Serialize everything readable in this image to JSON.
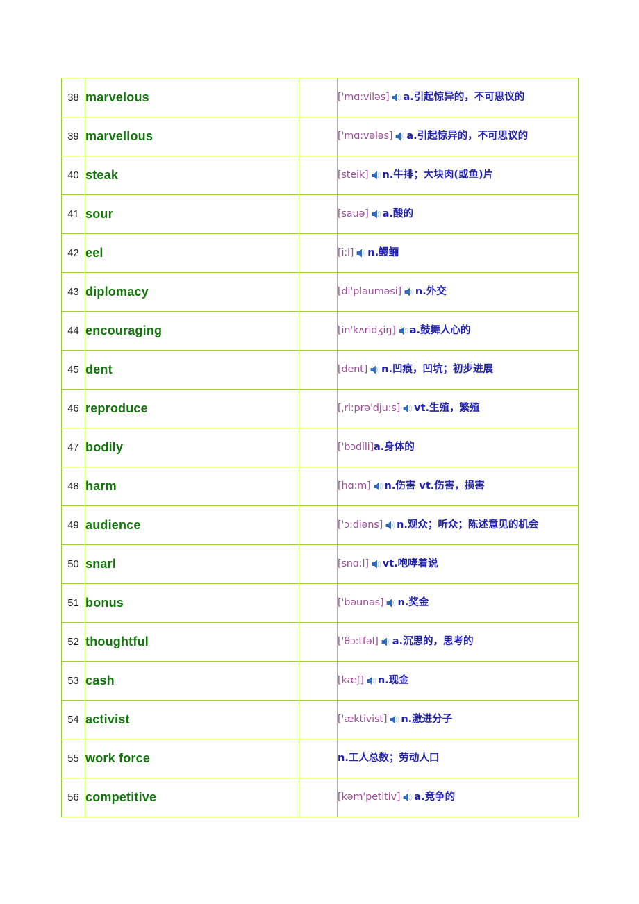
{
  "document": {
    "type": "vocabulary-table",
    "colors": {
      "border": "#9ACD32",
      "word": "#15730F",
      "phonetic": "#9B4F96",
      "meaning": "#2222AA",
      "number": "#1A1A1A"
    },
    "columns": [
      "number",
      "word",
      "spacer",
      "phonetic-and-meaning"
    ]
  },
  "rows": [
    {
      "num": "38",
      "word": "marvelous",
      "phon": "['mɑ:viləs]",
      "speaker": "speaker-icon",
      "meaning": "a.引起惊异的，不可思议的"
    },
    {
      "num": "39",
      "word": "marvellous",
      "phon": "['mɑ:vələs]",
      "speaker": "speaker-icon",
      "meaning": "a.引起惊异的，不可思议的"
    },
    {
      "num": "40",
      "word": "steak",
      "phon": "[steik]",
      "speaker": "speaker-icon",
      "meaning": "n.牛排；大块肉(或鱼)片"
    },
    {
      "num": "41",
      "word": "sour",
      "phon": "[sauə]",
      "speaker": "speaker-icon",
      "meaning": "a.酸的"
    },
    {
      "num": "42",
      "word": "eel",
      "phon": "[i:l]",
      "speaker": "speaker-icon",
      "meaning": "n.鳗鲡"
    },
    {
      "num": "43",
      "word": "diplomacy",
      "phon": "[di'pləuməsi]",
      "speaker": "speaker-icon",
      "meaning": "n.外交"
    },
    {
      "num": "44",
      "word": "encouraging",
      "phon": "[in'kʌridʒiŋ]",
      "speaker": "speaker-icon",
      "meaning": "a.鼓舞人心的"
    },
    {
      "num": "45",
      "word": "dent",
      "phon": "[dent]",
      "speaker": "speaker-icon",
      "meaning": "n.凹痕，凹坑；初步进展"
    },
    {
      "num": "46",
      "word": "reproduce",
      "phon": "[ˌri:prə'dju:s]",
      "speaker": "speaker-icon",
      "meaning": "vt.生殖，繁殖"
    },
    {
      "num": "47",
      "word": "bodily",
      "phon": "['bɔdili]",
      "speaker": "",
      "meaning": "a.身体的"
    },
    {
      "num": "48",
      "word": "harm",
      "phon": "[hɑ:m]",
      "speaker": "speaker-icon",
      "meaning": "n.伤害  vt.伤害，损害"
    },
    {
      "num": "49",
      "word": "audience",
      "phon": "['ɔ:diəns]",
      "speaker": "speaker-icon",
      "meaning": "n.观众；听众；陈述意见的机会"
    },
    {
      "num": "50",
      "word": "snarl",
      "phon": "[snɑ:l]",
      "speaker": "speaker-icon",
      "meaning": "vt.咆哮着说"
    },
    {
      "num": "51",
      "word": "bonus",
      "phon": "['bəunəs]",
      "speaker": "speaker-icon",
      "meaning": "n.奖金"
    },
    {
      "num": "52",
      "word": "thoughtful",
      "phon": "['θɔ:tfəl]",
      "speaker": "speaker-icon",
      "meaning": "a.沉思的，思考的"
    },
    {
      "num": "53",
      "word": "cash",
      "phon": "[kæʃ]",
      "speaker": "speaker-icon",
      "meaning": "n.现金"
    },
    {
      "num": "54",
      "word": "activist",
      "phon": "['æktivist]",
      "speaker": "speaker-icon",
      "meaning": "n.激进分子"
    },
    {
      "num": "55",
      "word": "work force",
      "phon": "",
      "speaker": "",
      "meaning": "n.工人总数；劳动人口"
    },
    {
      "num": "56",
      "word": "competitive",
      "phon": "[kəm'petitiv]",
      "speaker": "speaker-icon",
      "meaning": "a.竞争的"
    }
  ]
}
